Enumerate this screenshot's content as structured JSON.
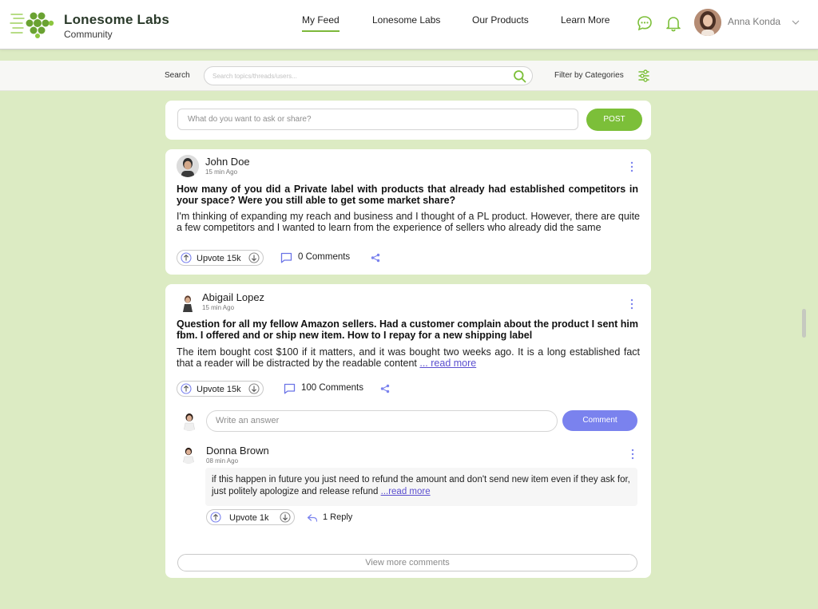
{
  "brand": {
    "title": "Lonesome Labs",
    "subtitle": "Community"
  },
  "nav": [
    {
      "label": "My Feed",
      "active": true
    },
    {
      "label": "Lonesome Labs",
      "active": false
    },
    {
      "label": "Our Products",
      "active": false
    },
    {
      "label": "Learn More",
      "active": false
    }
  ],
  "user": {
    "name": "Anna Konda"
  },
  "search": {
    "label": "Search",
    "placeholder": "Search topics/threads/users...",
    "filter_label": "Filter by Categories"
  },
  "composer": {
    "placeholder": "What do you want to ask or share?",
    "post_label": "POST"
  },
  "posts": [
    {
      "author": "John Doe",
      "time": "15 min Ago",
      "title": "How many of you did a Private label with products that already had established competitors in your space? Were you still able to get some market share?",
      "body": "I'm thinking of expanding my reach and business and I thought of a PL product. However, there are quite a few competitors and I wanted to learn from the experience of sellers who already did the same",
      "upvote_label": "Upvote 15k",
      "comments_label": "0 Comments"
    },
    {
      "author": "Abigail Lopez",
      "time": "15 min Ago",
      "title": "Question for all my fellow Amazon sellers. Had a customer complain about the product I sent him fbm. I offered and or ship new item. How to I repay for a new shipping label",
      "body": "The item bought cost $100 if it matters, and it was bought two weeks ago. It is a long established fact that a reader will be distracted by the readable content ",
      "read_more": "... read more",
      "upvote_label": "Upvote 15k",
      "comments_label": "100 Comments",
      "answer_placeholder": "Write an answer",
      "comment_button": "Comment",
      "reply": {
        "author": "Donna Brown",
        "time": "08 min Ago",
        "text": "if this happen in future you just need to refund the amount and don't send new item even if they ask for, just politely apologize and release refund ",
        "read_more": "...read more",
        "upvote_label": "Upvote 1k",
        "reply_label": "1 Reply"
      },
      "view_more": "View more comments"
    }
  ],
  "colors": {
    "brand_green": "#7cbf39",
    "comment_purple": "#7a82ee",
    "background": "#dcebc3",
    "link": "#5b4fcf"
  }
}
